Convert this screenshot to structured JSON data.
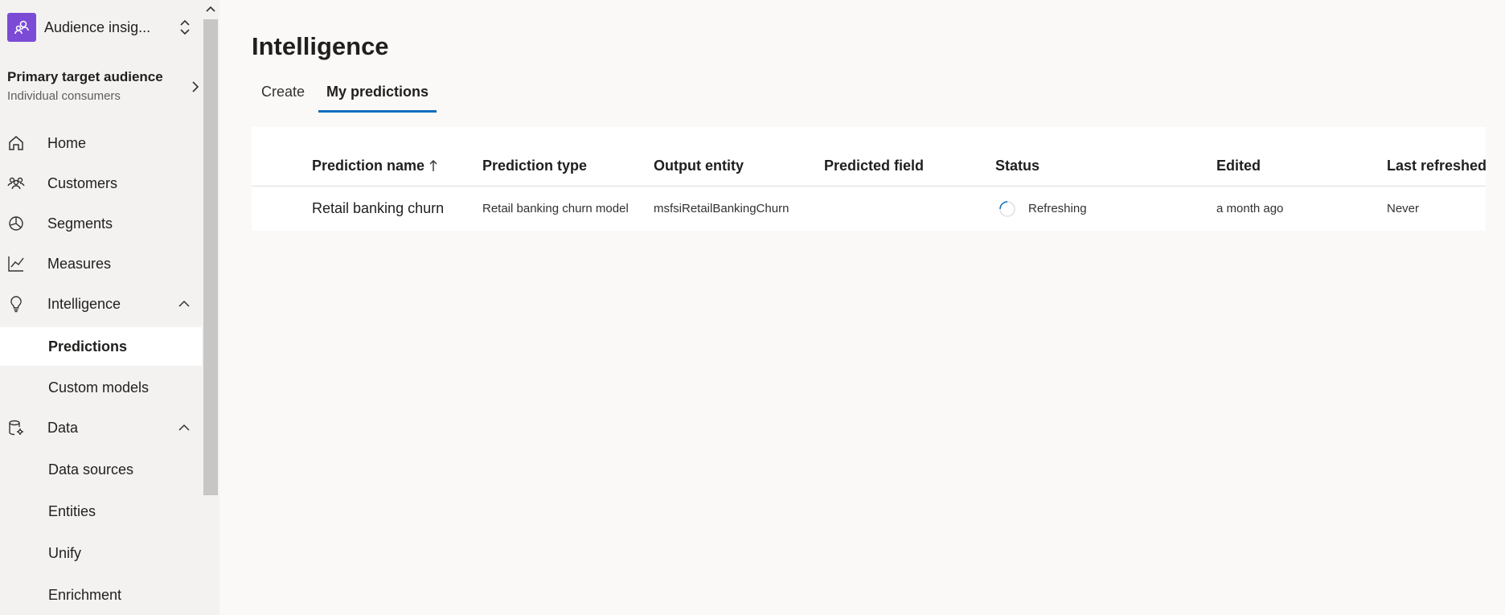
{
  "sidebar": {
    "app_name": "Audience insig...",
    "audience_title": "Primary target audience",
    "audience_subtitle": "Individual consumers",
    "items": [
      {
        "label": "Home"
      },
      {
        "label": "Customers"
      },
      {
        "label": "Segments"
      },
      {
        "label": "Measures"
      },
      {
        "label": "Intelligence"
      },
      {
        "label": "Predictions"
      },
      {
        "label": "Custom models"
      },
      {
        "label": "Data"
      },
      {
        "label": "Data sources"
      },
      {
        "label": "Entities"
      },
      {
        "label": "Unify"
      },
      {
        "label": "Enrichment"
      }
    ],
    "selected": "Predictions"
  },
  "main": {
    "title": "Intelligence",
    "tabs": [
      {
        "label": "Create"
      },
      {
        "label": "My predictions"
      }
    ],
    "active_tab": "My predictions"
  },
  "table": {
    "columns": [
      "Prediction name",
      "Prediction type",
      "Output entity",
      "Predicted field",
      "Status",
      "Edited",
      "Last refreshed"
    ],
    "rows": [
      {
        "name": "Retail banking churn",
        "type": "Retail banking churn model",
        "output_entity": "msfsiRetailBankingChurn",
        "predicted_field": "",
        "status": "Refreshing",
        "edited": "a month ago",
        "last_refreshed": "Never"
      }
    ]
  },
  "colors": {
    "accent": "#0f6cbd",
    "app_logo": "#7b4bd6",
    "spinner": "#0f6cbd"
  }
}
